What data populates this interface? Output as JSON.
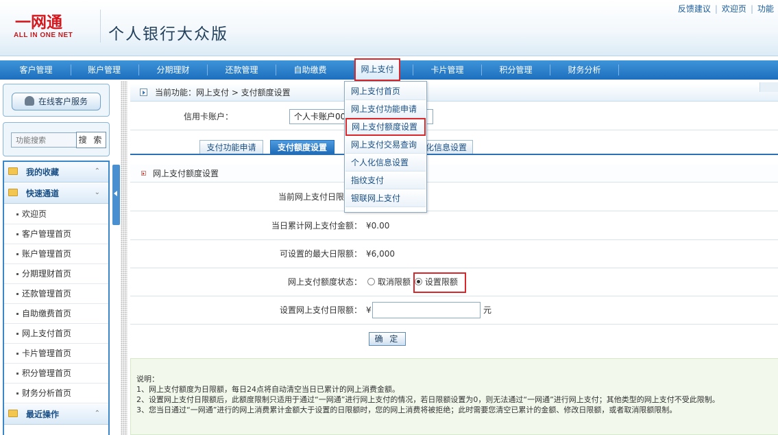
{
  "header": {
    "logo_text": "一网通",
    "logo_subtext": "ALL IN ONE NET",
    "app_title": "个人银行大众版",
    "top_links": [
      "反馈建议",
      "欢迎页",
      "功能"
    ]
  },
  "nav": {
    "items": [
      {
        "label": "客户管理"
      },
      {
        "label": "账户管理"
      },
      {
        "label": "分期理财"
      },
      {
        "label": "还款管理"
      },
      {
        "label": "自助缴费"
      },
      {
        "label": "网上支付",
        "active": true
      },
      {
        "label": "卡片管理"
      },
      {
        "label": "积分管理"
      },
      {
        "label": "财务分析"
      }
    ]
  },
  "dropdown": {
    "items": [
      {
        "label": "网上支付首页"
      },
      {
        "label": "网上支付功能申请"
      },
      {
        "label": "网上支付额度设置",
        "highlighted": true
      },
      {
        "label": "网上支付交易查询"
      },
      {
        "label": "个人化信息设置"
      },
      {
        "label": "指纹支付"
      },
      {
        "label": "银联网上支付"
      }
    ]
  },
  "sidebar": {
    "online_service": "在线客户服务",
    "search_placeholder": "功能搜索",
    "search_button": "搜 索",
    "favorites": "我的收藏",
    "quick_channel": "快速通道",
    "quick_items": [
      "欢迎页",
      "客户管理首页",
      "账户管理首页",
      "分期理财首页",
      "还款管理首页",
      "自助缴费首页",
      "网上支付首页",
      "卡片管理首页",
      "积分管理首页",
      "财务分析首页"
    ],
    "recent": "最近操作"
  },
  "breadcrumb": "当前功能：网上支付 > 支付额度设置",
  "account": {
    "label": "信用卡账户：",
    "value": "个人卡账户00"
  },
  "tabs": [
    {
      "label": "支付功能申请"
    },
    {
      "label": "支付额度设置",
      "active": true
    },
    {
      "label": "化信息设置"
    }
  ],
  "section_title": "网上支付额度设置",
  "form": {
    "current_limit_label": "当前网上支付日限",
    "accumulated_label": "当日累计网上支付金额：",
    "accumulated_value": "¥0.00",
    "max_limit_label": "可设置的最大日限额：",
    "max_limit_value": "¥6,000",
    "status_label": "网上支付额度状态：",
    "status_options": [
      "取消限额",
      "设置限额"
    ],
    "status_selected": "设置限额",
    "set_limit_label": "设置网上支付日限额：",
    "currency_symbol": "¥",
    "unit": "元",
    "confirm": "确 定"
  },
  "notes": {
    "title": "说明：",
    "lines": [
      "1、网上支付额度为日限额，每日24点将自动清空当日已累计的网上消费金额。",
      "2、设置网上支付日限额后，此额度限制只适用于通过“一网通”进行网上支付的情况，若日限额设置为0，则无法通过“一网通”进行网上支付；其他类型的网上支付不受此限制。",
      "3、您当日通过“一网通”进行的网上消费累计金额大于设置的日限额时，您的网上消费将被拒绝；此时需要您清空已累计的金额、修改日限额，或者取消限额限制。"
    ]
  },
  "colors": {
    "nav_blue": "#1d6fbe",
    "highlight_red": "#d8262b",
    "logo_red": "#d3181e",
    "notes_bg": "#f2f9ec"
  }
}
